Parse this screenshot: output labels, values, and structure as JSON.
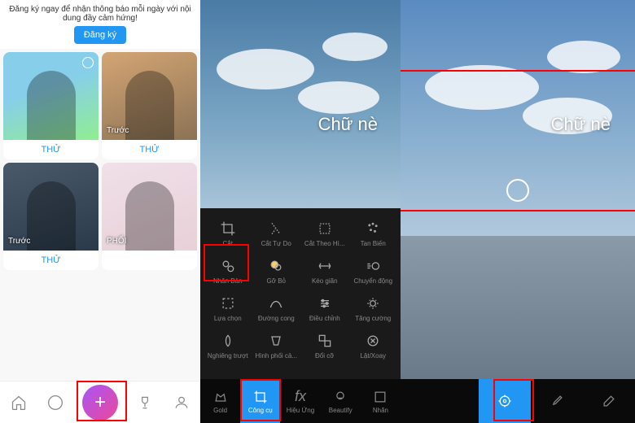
{
  "panel1": {
    "header": "Đăng ký ngay để nhận thông báo mỗi ngày với nội dung đầy cảm hứng!",
    "register": "Đăng ký",
    "badges": {
      "before": "Trước",
      "mix": "PHỐI"
    },
    "try": "THỬ"
  },
  "panel2": {
    "overlay": "Chữ nè",
    "tools": {
      "r1": [
        "Cắt",
        "Cắt Tự Do",
        "Cắt Theo Hì...",
        "Tan Biến"
      ],
      "r2": [
        "Nhân Bản",
        "Gỡ Bỏ",
        "Kéo giãn",
        "Chuyển động"
      ],
      "r3": [
        "Lựa chọn",
        "Đường cong",
        "Điều chỉnh",
        "Tăng cường"
      ],
      "r4": [
        "Nghiêng trượt",
        "Hình phối cả...",
        "Đổi cỡ",
        "Lật/Xoay"
      ]
    },
    "tabs": [
      "Gold",
      "Công cụ",
      "fx",
      "Hiệu Ứng",
      "Beautify",
      "Nhãn"
    ]
  },
  "panel3": {
    "overlay": "Chữ nè"
  }
}
